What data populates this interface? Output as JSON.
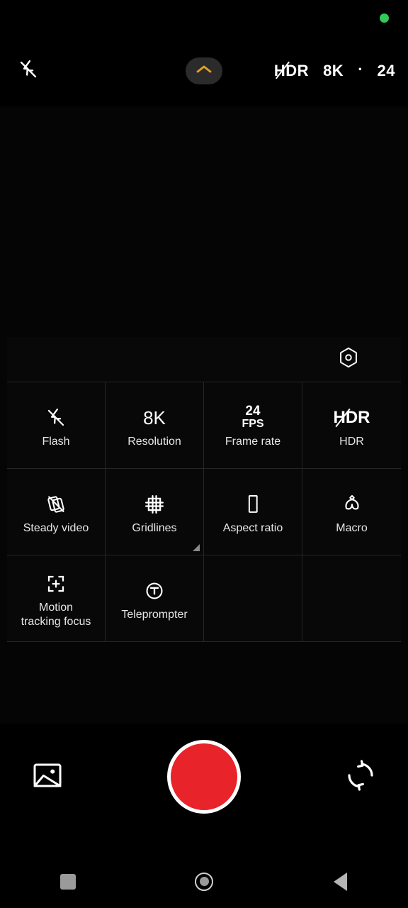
{
  "status": {
    "privacy_indicator": "green-recording-dot",
    "privacy_color": "#32c85a"
  },
  "top_bar": {
    "flash_icon": "flash-off-icon",
    "collapse_icon": "chevron-up-icon",
    "collapse_accent_color": "#e8a020",
    "indicators": {
      "hdr_label": "HDR",
      "hdr_state": "off",
      "resolution": "8K",
      "separator": "·",
      "frame_rate": "24"
    }
  },
  "settings_panel": {
    "header": {
      "more_settings_icon": "hexagon-settings-icon"
    },
    "items": [
      {
        "label": "Flash",
        "icon": "flash-off-icon",
        "value_text": "",
        "has_submenu": false
      },
      {
        "label": "Resolution",
        "icon": "resolution-text-icon",
        "value_text": "8K",
        "has_submenu": false
      },
      {
        "label": "Frame rate",
        "icon": "frame-rate-text-icon",
        "value_text": "24",
        "value_unit": "FPS",
        "has_submenu": false
      },
      {
        "label": "HDR",
        "icon": "hdr-off-icon",
        "value_text": "HDR",
        "has_submenu": false
      },
      {
        "label": "Steady video",
        "icon": "steady-video-off-icon",
        "value_text": "",
        "has_submenu": false
      },
      {
        "label": "Gridlines",
        "icon": "gridlines-icon",
        "value_text": "",
        "has_submenu": true
      },
      {
        "label": "Aspect ratio",
        "icon": "aspect-ratio-icon",
        "value_text": "",
        "has_submenu": false
      },
      {
        "label": "Macro",
        "icon": "macro-flower-icon",
        "value_text": "",
        "has_submenu": false
      },
      {
        "label": "Motion\ntracking focus",
        "icon": "motion-tracking-focus-icon",
        "value_text": "",
        "has_submenu": false
      },
      {
        "label": "Teleprompter",
        "icon": "teleprompter-icon",
        "value_text": "",
        "has_submenu": false
      }
    ]
  },
  "shutter_bar": {
    "gallery_icon": "gallery-image-icon",
    "record_button": "record-button",
    "record_color": "#e8232a",
    "flip_icon": "flip-camera-icon"
  },
  "nav_bar": {
    "recents": "recents-square-icon",
    "home": "home-circle-icon",
    "back": "back-triangle-icon"
  }
}
